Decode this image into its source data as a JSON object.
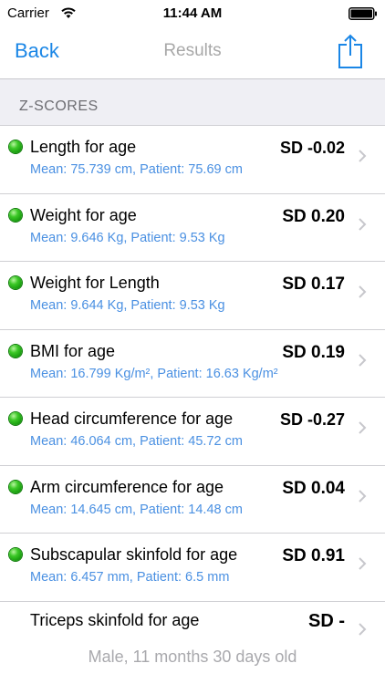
{
  "status_bar": {
    "carrier": "Carrier",
    "time": "11:44 AM",
    "icons": [
      "wifi-icon",
      "battery-icon"
    ]
  },
  "nav": {
    "back_label": "Back",
    "title": "Results",
    "share_icon": "share-icon"
  },
  "section": {
    "header": "Z-SCORES"
  },
  "rows": [
    {
      "title": "Length for age",
      "subtitle": "Mean: 75.739 cm, Patient: 75.69 cm",
      "sd": "SD -0.02",
      "status": "green"
    },
    {
      "title": "Weight for age",
      "subtitle": "Mean: 9.646 Kg, Patient: 9.53 Kg",
      "sd": "SD 0.20",
      "status": "green"
    },
    {
      "title": "Weight for Length",
      "subtitle": "Mean: 9.644 Kg, Patient: 9.53 Kg",
      "sd": "SD 0.17",
      "status": "green"
    },
    {
      "title": "BMI for age",
      "subtitle": "Mean: 16.799 Kg/m², Patient: 16.63 Kg/m²",
      "sd": "SD 0.19",
      "status": "green"
    },
    {
      "title": "Head circumference for age",
      "subtitle": "Mean: 46.064 cm, Patient: 45.72 cm",
      "sd": "SD -0.27",
      "status": "green"
    },
    {
      "title": "Arm circumference for age",
      "subtitle": "Mean: 14.645 cm, Patient: 14.48 cm",
      "sd": "SD 0.04",
      "status": "green"
    },
    {
      "title": "Subscapular skinfold for age",
      "subtitle": "Mean: 6.457 mm, Patient: 6.5 mm",
      "sd": "SD 0.91",
      "status": "green"
    },
    {
      "title": "Triceps skinfold for age",
      "subtitle": "",
      "sd": "SD -",
      "status": "none"
    }
  ],
  "footer": {
    "text": "Male,  11 months 30 days old"
  },
  "colors": {
    "accent": "#1a86e6",
    "subtitle": "#4a90e2",
    "status_green": "#2fb81e",
    "section_bg": "#efeff4"
  }
}
